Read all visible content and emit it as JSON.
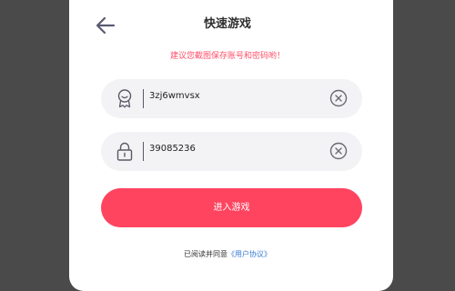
{
  "header": {
    "title": "快速游戏"
  },
  "notice": "建议您截图保存账号和密码哟！",
  "username_field": {
    "value": "3zj6wmvsx",
    "icon": "user-badge-icon"
  },
  "password_field": {
    "value": "39085236",
    "icon": "lock-icon"
  },
  "enter_button": {
    "label": "进入游戏"
  },
  "agreement": {
    "prefix": "已阅读并同意",
    "link": "《用户协议》"
  },
  "colors": {
    "accent": "#ff445f",
    "link": "#3a7bd5",
    "overlay": "#4a4a4a"
  }
}
